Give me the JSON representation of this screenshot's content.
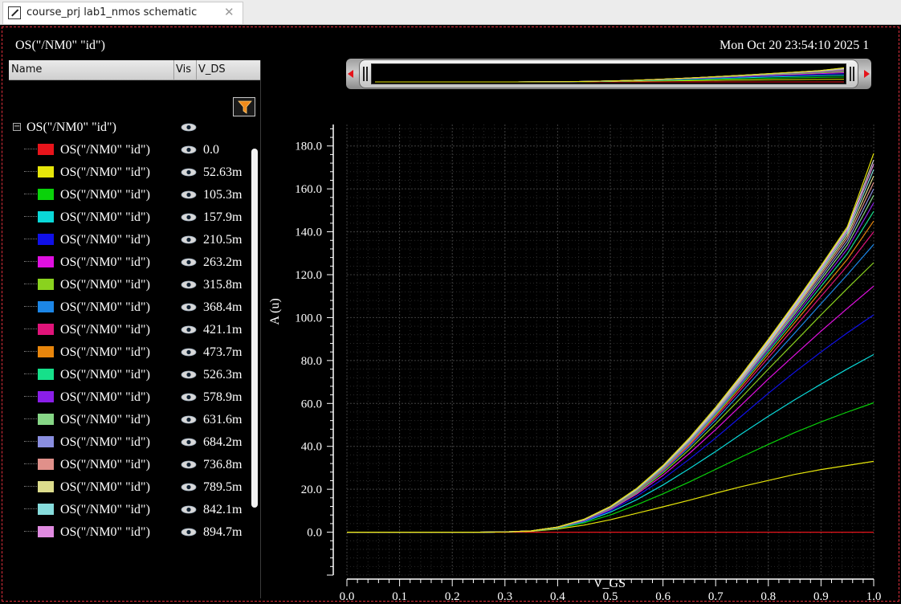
{
  "tab": {
    "title": "course_prj lab1_nmos schematic",
    "close_glyph": "✕",
    "icon": "schematic-icon"
  },
  "header": {
    "plot_name": "OS(\"/NM0\" \"id\")",
    "timestamp": "Mon Oct 20 23:54:10 2025  1"
  },
  "legend": {
    "columns": {
      "name": "Name",
      "vis": "Vis",
      "param": "V_DS"
    },
    "filter_icon": "filter-icon",
    "group_label": "OS(\"/NM0\" \"id\")",
    "group_expand_glyph": "−",
    "rows": [
      {
        "label": "OS(\"/NM0\" \"id\")",
        "value": "0.0",
        "color": "#e8141b"
      },
      {
        "label": "OS(\"/NM0\" \"id\")",
        "value": "52.63m",
        "color": "#e6e60a"
      },
      {
        "label": "OS(\"/NM0\" \"id\")",
        "value": "105.3m",
        "color": "#0ad20a"
      },
      {
        "label": "OS(\"/NM0\" \"id\")",
        "value": "157.9m",
        "color": "#0ad8d8"
      },
      {
        "label": "OS(\"/NM0\" \"id\")",
        "value": "210.5m",
        "color": "#1010e8"
      },
      {
        "label": "OS(\"/NM0\" \"id\")",
        "value": "263.2m",
        "color": "#e010e0"
      },
      {
        "label": "OS(\"/NM0\" \"id\")",
        "value": "315.8m",
        "color": "#8ad21e"
      },
      {
        "label": "OS(\"/NM0\" \"id\")",
        "value": "368.4m",
        "color": "#1c86e6"
      },
      {
        "label": "OS(\"/NM0\" \"id\")",
        "value": "421.1m",
        "color": "#e0147a"
      },
      {
        "label": "OS(\"/NM0\" \"id\")",
        "value": "473.7m",
        "color": "#e8860c"
      },
      {
        "label": "OS(\"/NM0\" \"id\")",
        "value": "526.3m",
        "color": "#16e08a"
      },
      {
        "label": "OS(\"/NM0\" \"id\")",
        "value": "578.9m",
        "color": "#8a1ee8"
      },
      {
        "label": "OS(\"/NM0\" \"id\")",
        "value": "631.6m",
        "color": "#86d686"
      },
      {
        "label": "OS(\"/NM0\" \"id\")",
        "value": "684.2m",
        "color": "#8a8ee0"
      },
      {
        "label": "OS(\"/NM0\" \"id\")",
        "value": "736.8m",
        "color": "#e0908a"
      },
      {
        "label": "OS(\"/NM0\" \"id\")",
        "value": "789.5m",
        "color": "#dcdc8c"
      },
      {
        "label": "OS(\"/NM0\" \"id\")",
        "value": "842.1m",
        "color": "#86dcdc"
      },
      {
        "label": "OS(\"/NM0\" \"id\")",
        "value": "894.7m",
        "color": "#e08ae0"
      }
    ],
    "eye_icon": "eye-icon"
  },
  "zoom_slider": {
    "left_arrow_icon": "arrow-left-icon",
    "right_arrow_icon": "arrow-right-icon"
  },
  "chart_data": {
    "type": "line",
    "title": "",
    "xlabel": "V_GS",
    "ylabel": "A (u)",
    "xlim": [
      0.0,
      1.0
    ],
    "ylim": [
      -20,
      190
    ],
    "x_ticks": [
      "0.0",
      "0.1",
      "0.2",
      "0.3",
      "0.4",
      "0.5",
      "0.6",
      "0.7",
      "0.8",
      "0.9",
      "1.0"
    ],
    "y_ticks": [
      "0.0",
      "20.0",
      "40.0",
      "60.0",
      "80.0",
      "100.0",
      "120.0",
      "140.0",
      "160.0",
      "180.0"
    ],
    "grid": true,
    "x": [
      0.0,
      0.25,
      0.3,
      0.35,
      0.4,
      0.45,
      0.5,
      0.55,
      0.6,
      0.65,
      0.7,
      0.75,
      0.8,
      0.85,
      0.9,
      0.95,
      1.0
    ],
    "series": [
      {
        "color": "#e8141b",
        "values": [
          0,
          0,
          0,
          0,
          0,
          0,
          0,
          0,
          0,
          0,
          0,
          0,
          0,
          0,
          0,
          0,
          0
        ]
      },
      {
        "color": "#e6e60a",
        "values": [
          0,
          0,
          0.1,
          0.4,
          1.5,
          3.3,
          5.8,
          8.8,
          11.8,
          14.9,
          18.2,
          21.3,
          24.1,
          26.9,
          29.2,
          31.1,
          33.0
        ]
      },
      {
        "color": "#0ad20a",
        "values": [
          0,
          0,
          0.1,
          0.5,
          1.8,
          4.3,
          8.0,
          12.7,
          17.9,
          23.4,
          29.3,
          35.2,
          40.9,
          46.4,
          51.4,
          56.0,
          60.3
        ]
      },
      {
        "color": "#0ad8d8",
        "values": [
          0,
          0,
          0.1,
          0.5,
          1.9,
          4.8,
          9.3,
          15.1,
          22.0,
          29.6,
          37.6,
          46.0,
          54.0,
          61.7,
          69.0,
          76.1,
          82.8
        ]
      },
      {
        "color": "#1010e8",
        "values": [
          0,
          0,
          0.1,
          0.6,
          2.0,
          5.1,
          10.0,
          16.7,
          24.8,
          34.0,
          43.9,
          54.3,
          64.7,
          74.6,
          84.0,
          92.9,
          101.3
        ]
      },
      {
        "color": "#e010e0",
        "values": [
          0,
          0,
          0.1,
          0.6,
          2.1,
          5.3,
          10.5,
          17.7,
          26.5,
          36.7,
          47.8,
          59.6,
          71.4,
          82.6,
          93.7,
          104.3,
          114.7
        ]
      },
      {
        "color": "#8ad21e",
        "values": [
          0,
          0,
          0.1,
          0.6,
          2.1,
          5.4,
          10.8,
          18.3,
          27.6,
          38.5,
          50.5,
          63.1,
          76.0,
          88.6,
          101.3,
          113.6,
          125.6
        ]
      },
      {
        "color": "#1c86e6",
        "values": [
          0,
          0,
          0.1,
          0.6,
          2.2,
          5.5,
          11.0,
          18.7,
          28.4,
          39.7,
          52.2,
          65.5,
          79.2,
          92.8,
          106.5,
          120.0,
          134.1
        ]
      },
      {
        "color": "#e0147a",
        "values": [
          0,
          0,
          0.1,
          0.6,
          2.2,
          5.6,
          11.2,
          19.0,
          28.9,
          40.5,
          53.4,
          67.1,
          81.3,
          95.6,
          109.9,
          124.1,
          140.0
        ]
      },
      {
        "color": "#e8860c",
        "values": [
          0,
          0,
          0.1,
          0.6,
          2.2,
          5.6,
          11.3,
          19.2,
          29.3,
          41.1,
          54.3,
          68.3,
          82.9,
          97.6,
          112.4,
          127.2,
          145.0
        ]
      },
      {
        "color": "#16e08a",
        "values": [
          0,
          0,
          0.1,
          0.6,
          2.3,
          5.7,
          11.4,
          19.4,
          29.6,
          41.6,
          55.0,
          69.3,
          84.1,
          99.2,
          114.5,
          129.8,
          149.5
        ]
      },
      {
        "color": "#8a1ee8",
        "values": [
          0,
          0,
          0.1,
          0.6,
          2.3,
          5.7,
          11.5,
          19.6,
          29.9,
          42.0,
          55.6,
          70.1,
          85.1,
          100.5,
          116.2,
          132.0,
          153.5
        ]
      },
      {
        "color": "#86d686",
        "values": [
          0,
          0,
          0.1,
          0.6,
          2.3,
          5.8,
          11.6,
          19.7,
          30.1,
          42.4,
          56.1,
          70.8,
          86.0,
          101.7,
          117.7,
          133.9,
          157.0
        ]
      },
      {
        "color": "#8a8ee0",
        "values": [
          0,
          0,
          0.1,
          0.6,
          2.3,
          5.8,
          11.7,
          19.9,
          30.3,
          42.7,
          56.5,
          71.4,
          86.8,
          102.7,
          119.0,
          135.6,
          160.0
        ]
      },
      {
        "color": "#e0908a",
        "values": [
          0,
          0,
          0.1,
          0.6,
          2.3,
          5.8,
          11.7,
          20.0,
          30.5,
          43.0,
          56.9,
          71.9,
          87.5,
          103.6,
          120.2,
          137.1,
          163.0
        ]
      },
      {
        "color": "#dcdc8c",
        "values": [
          0,
          0,
          0.1,
          0.6,
          2.3,
          5.9,
          11.8,
          20.1,
          30.7,
          43.2,
          57.2,
          72.4,
          88.1,
          104.4,
          121.2,
          138.4,
          166.0
        ]
      },
      {
        "color": "#86dcdc",
        "values": [
          0,
          0,
          0.1,
          0.6,
          2.4,
          5.9,
          11.8,
          20.2,
          30.8,
          43.4,
          57.5,
          72.8,
          88.6,
          105.1,
          122.1,
          139.6,
          169.0
        ]
      },
      {
        "color": "#e08ae0",
        "values": [
          0,
          0,
          0.1,
          0.6,
          2.4,
          5.9,
          11.9,
          20.3,
          30.9,
          43.6,
          57.8,
          73.1,
          89.1,
          105.7,
          122.9,
          140.6,
          171.5
        ]
      },
      {
        "color": "#d2d2d2",
        "values": [
          0,
          0,
          0.1,
          0.6,
          2.4,
          5.9,
          11.9,
          20.3,
          31.0,
          43.8,
          58.0,
          73.4,
          89.5,
          106.3,
          123.6,
          141.5,
          173.5
        ]
      },
      {
        "color": "#e6e60a",
        "values": [
          0,
          0,
          0.1,
          0.6,
          2.4,
          6.0,
          12.0,
          20.4,
          31.1,
          43.9,
          58.2,
          73.7,
          89.9,
          106.8,
          124.2,
          142.4,
          176.5
        ]
      }
    ]
  }
}
